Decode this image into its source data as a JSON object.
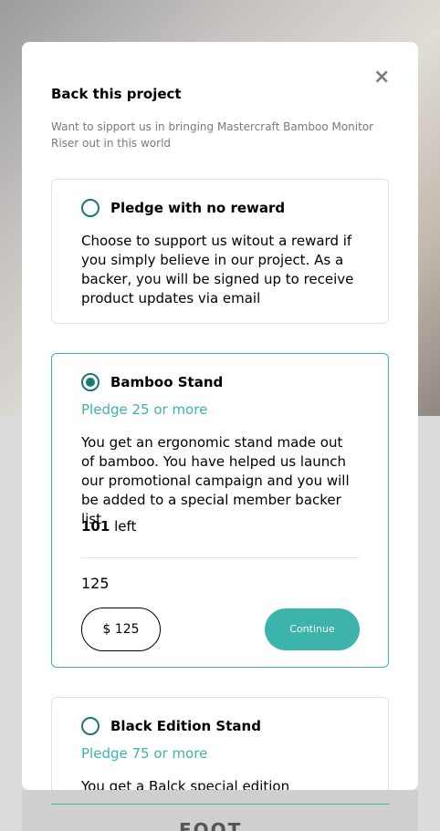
{
  "background": {
    "logo_text": "FOOT"
  },
  "modal": {
    "close_icon": "×",
    "title": "Back this project",
    "description": "Want to sipport us in bringing Mastercraft Bamboo Monitor Riser out in this world"
  },
  "pledges": [
    {
      "title": "Pledge with no reward",
      "description": "Choose to support us witout a reward if you simply believe in our project. As a backer, you will be signed up to receive product updates via email",
      "selected": false
    },
    {
      "title": "Bamboo Stand",
      "pledge_label": "Pledge 25 or more",
      "description": "You get an ergonomic stand made out of bamboo. You have helped us launch our promotional campaign and you will be added to a special member backer list",
      "left_count": "101",
      "left_label": "left",
      "amount_text": "125",
      "amount_input_value": "$ 125",
      "continue_label": "Continue",
      "selected": true
    },
    {
      "title": "Black Edition Stand",
      "pledge_label": "Pledge 75 or more",
      "description": "You get a Balck special edition computer",
      "selected": false
    }
  ],
  "colors": {
    "accent": "#3cb3ab",
    "accent_dark": "#147b74"
  }
}
